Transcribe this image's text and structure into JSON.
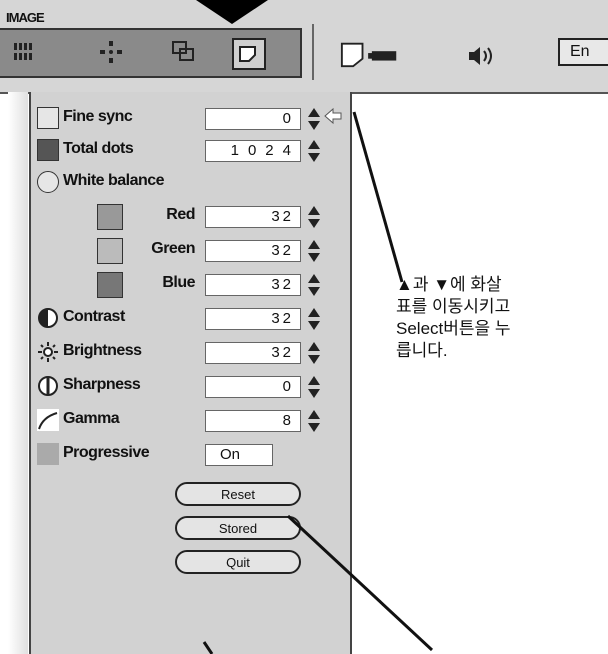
{
  "menubar": {
    "title": "IMAGE",
    "language_button": "En",
    "icons": [
      "image-adjust-icon",
      "move-icon",
      "pc-adjust-icon",
      "screen-icon",
      "projector-icon",
      "sound-icon"
    ]
  },
  "panel": {
    "rows": [
      {
        "label": "Fine sync",
        "value": "0",
        "icon": "fine-sync-icon"
      },
      {
        "label": "Total dots",
        "value": "1024",
        "icon": "total-dots-icon"
      },
      {
        "label": "White balance",
        "value": "",
        "icon": "white-balance-icon"
      },
      {
        "label": "Red",
        "value": "32",
        "icon": "red-icon"
      },
      {
        "label": "Green",
        "value": "32",
        "icon": "green-icon"
      },
      {
        "label": "Blue",
        "value": "32",
        "icon": "blue-icon"
      },
      {
        "label": "Contrast",
        "value": "32",
        "icon": "contrast-icon"
      },
      {
        "label": "Brightness",
        "value": "32",
        "icon": "brightness-icon"
      },
      {
        "label": "Sharpness",
        "value": "0",
        "icon": "sharpness-icon"
      },
      {
        "label": "Gamma",
        "value": "8",
        "icon": "gamma-icon"
      },
      {
        "label": "Progressive",
        "value": "On",
        "icon": "progressive-icon"
      }
    ],
    "buttons": {
      "reset": "Reset",
      "stored": "Stored",
      "quit": "Quit"
    }
  },
  "annotation": {
    "line1": "▲과 ▼에 화살",
    "line2": "표를 이동시키고",
    "line3": "Select버튼을 누",
    "line4": "릅니다."
  }
}
